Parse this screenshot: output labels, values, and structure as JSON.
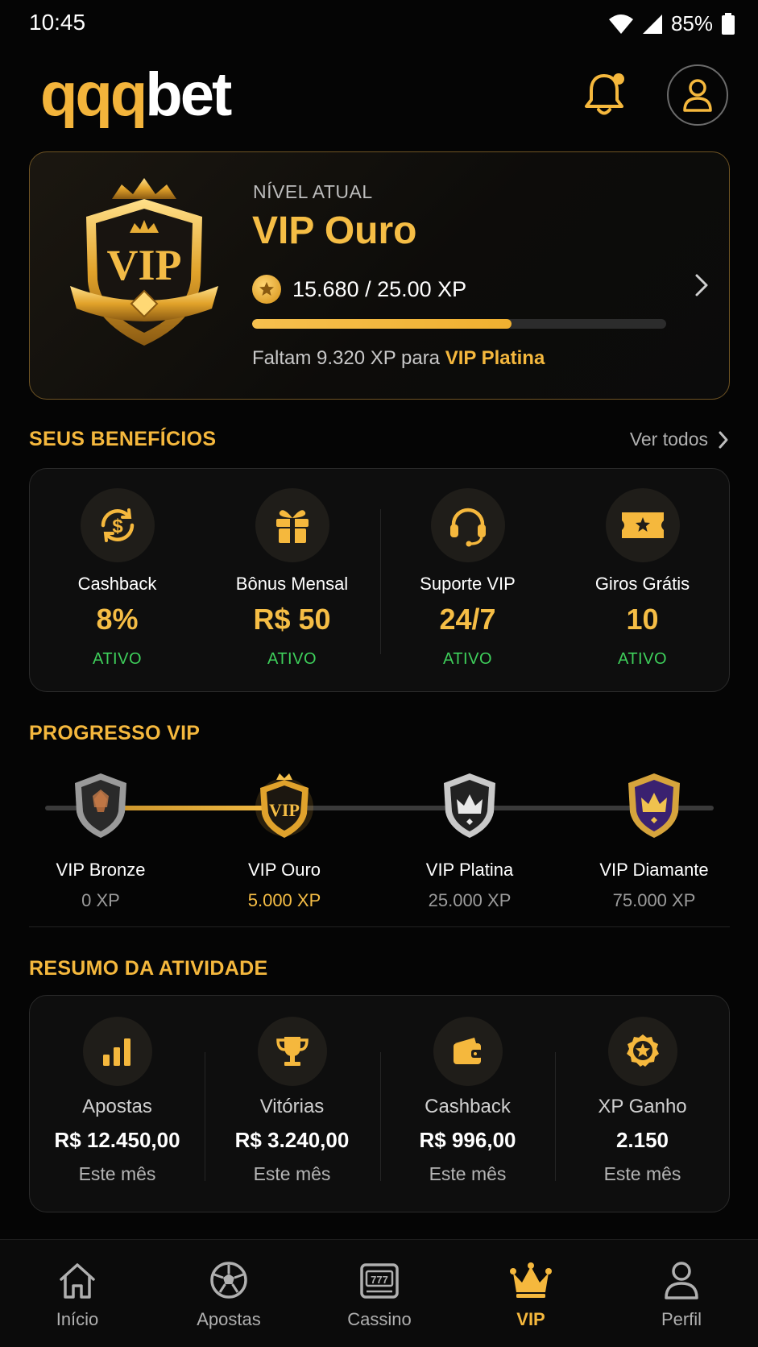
{
  "status_bar": {
    "time": "10:45",
    "battery": "85%"
  },
  "header": {
    "logo_prefix": "qqq",
    "logo_suffix": "bet"
  },
  "vip_card": {
    "level_label": "NÍVEL ATUAL",
    "level_name": "VIP Ouro",
    "badge_text": "VIP",
    "xp_text": "15.680 / 25.00 XP",
    "progress_fraction": 0.6272,
    "remaining_prefix": "Faltam 9.320 XP para",
    "remaining_target": "VIP Platina"
  },
  "benefits": {
    "title": "SEUS BENEFÍCIOS",
    "see_all": "Ver todos",
    "items": [
      {
        "label": "Cashback",
        "value": "8%",
        "status": "ATIVO",
        "icon": "cashback-icon"
      },
      {
        "label": "Bônus Mensal",
        "value": "R$ 50",
        "status": "ATIVO",
        "icon": "gift-icon"
      },
      {
        "label": "Suporte VIP",
        "value": "24/7",
        "status": "ATIVO",
        "icon": "headset-icon"
      },
      {
        "label": "Giros Grátis",
        "value": "10",
        "status": "ATIVO",
        "icon": "ticket-icon"
      }
    ]
  },
  "progress": {
    "title": "PROGRESSO VIP",
    "tiers": [
      {
        "name": "VIP Bronze",
        "xp": "0 XP",
        "icon": "bronze-shield-icon"
      },
      {
        "name": "VIP Ouro",
        "xp": "5.000 XP",
        "icon": "gold-vip-shield-icon",
        "current": true
      },
      {
        "name": "VIP Platina",
        "xp": "25.000 XP",
        "icon": "platinum-shield-icon"
      },
      {
        "name": "VIP Diamante",
        "xp": "75.000 XP",
        "icon": "diamond-shield-icon"
      }
    ]
  },
  "activity": {
    "title": "RESUMO DA ATIVIDADE",
    "items": [
      {
        "label": "Apostas",
        "value": "R$ 12.450,00",
        "sub": "Este mês",
        "icon": "bar-chart-icon"
      },
      {
        "label": "Vitórias",
        "value": "R$ 3.240,00",
        "sub": "Este mês",
        "icon": "trophy-icon"
      },
      {
        "label": "Cashback",
        "value": "R$ 996,00",
        "sub": "Este mês",
        "icon": "wallet-icon"
      },
      {
        "label": "XP Ganho",
        "value": "2.150",
        "sub": "Este mês",
        "icon": "medal-icon"
      }
    ]
  },
  "nav": {
    "items": [
      {
        "label": "Início",
        "icon": "home-icon"
      },
      {
        "label": "Apostas",
        "icon": "soccer-ball-icon"
      },
      {
        "label": "Cassino",
        "icon": "slot-machine-icon"
      },
      {
        "label": "VIP",
        "icon": "crown-icon",
        "active": true
      },
      {
        "label": "Perfil",
        "icon": "person-icon"
      }
    ]
  },
  "colors": {
    "accent": "#f5b83d",
    "active_green": "#3ecf5b",
    "background": "#050505"
  }
}
